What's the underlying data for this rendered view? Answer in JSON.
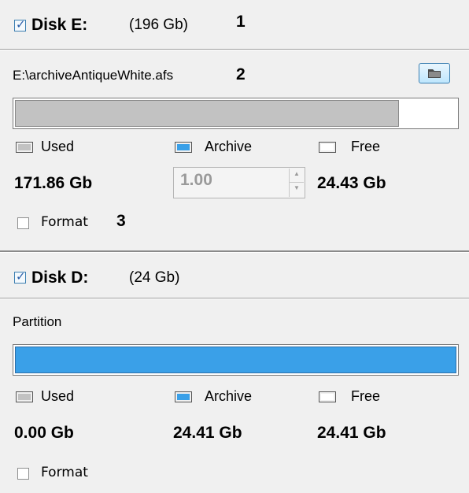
{
  "disk_e": {
    "checked": true,
    "title": "Disk E:",
    "size": "(196 Gb)",
    "annotation_1": "1",
    "path": "E:\\archiveAntiqueWhite.afs",
    "annotation_2": "2",
    "used_fraction": 0.87,
    "legend": {
      "used": "Used",
      "archive": "Archive",
      "free": "Free"
    },
    "used_value": "171.86 Gb",
    "archive_spin_value": "1.00",
    "free_value": "24.43 Gb",
    "format_label": "Format",
    "format_checked": false,
    "annotation_3": "3"
  },
  "disk_d": {
    "checked": true,
    "title": "Disk D:",
    "size": "(24 Gb)",
    "partition_label": "Partition",
    "archive_fraction": 1.0,
    "legend": {
      "used": "Used",
      "archive": "Archive",
      "free": "Free"
    },
    "used_value": "0.00 Gb",
    "archive_value": "24.41 Gb",
    "free_value": "24.41 Gb",
    "format_label": "Format",
    "format_checked": false
  },
  "colors": {
    "used": "#c2c2c2",
    "archive": "#3aa0e8",
    "free": "#ffffff"
  }
}
